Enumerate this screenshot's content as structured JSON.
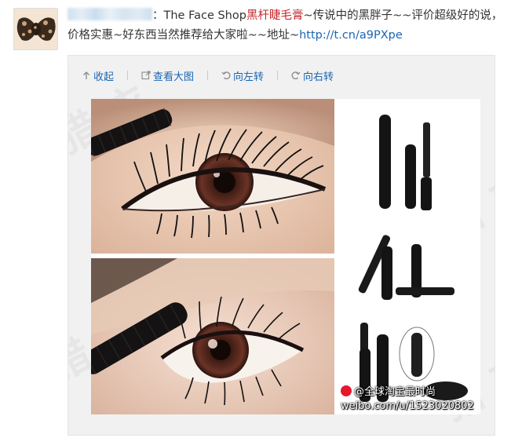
{
  "post": {
    "brand": "The Face Shop",
    "product": "黑杆睫毛膏",
    "text_after_product": "~传说中的黑胖子~~评价超级好的说，价格实惠~好东西当然推荐给大家啦~~地址~",
    "colon": "：",
    "link": "http://t.cn/a9PXpe"
  },
  "toolbar": {
    "collapse": "收起",
    "view_large": "查看大图",
    "rotate_left": "向左转",
    "rotate_right": "向右转"
  },
  "image": {
    "credit_handle": "@全球淘宝最时尚",
    "credit_url": "weibo.com/u/1523020802"
  },
  "colors": {
    "link": "#1a66b3",
    "product_highlight": "#c4282d"
  },
  "icons": [
    "up-arrow-icon",
    "external-view-icon",
    "rotate-left-icon",
    "rotate-right-icon"
  ]
}
